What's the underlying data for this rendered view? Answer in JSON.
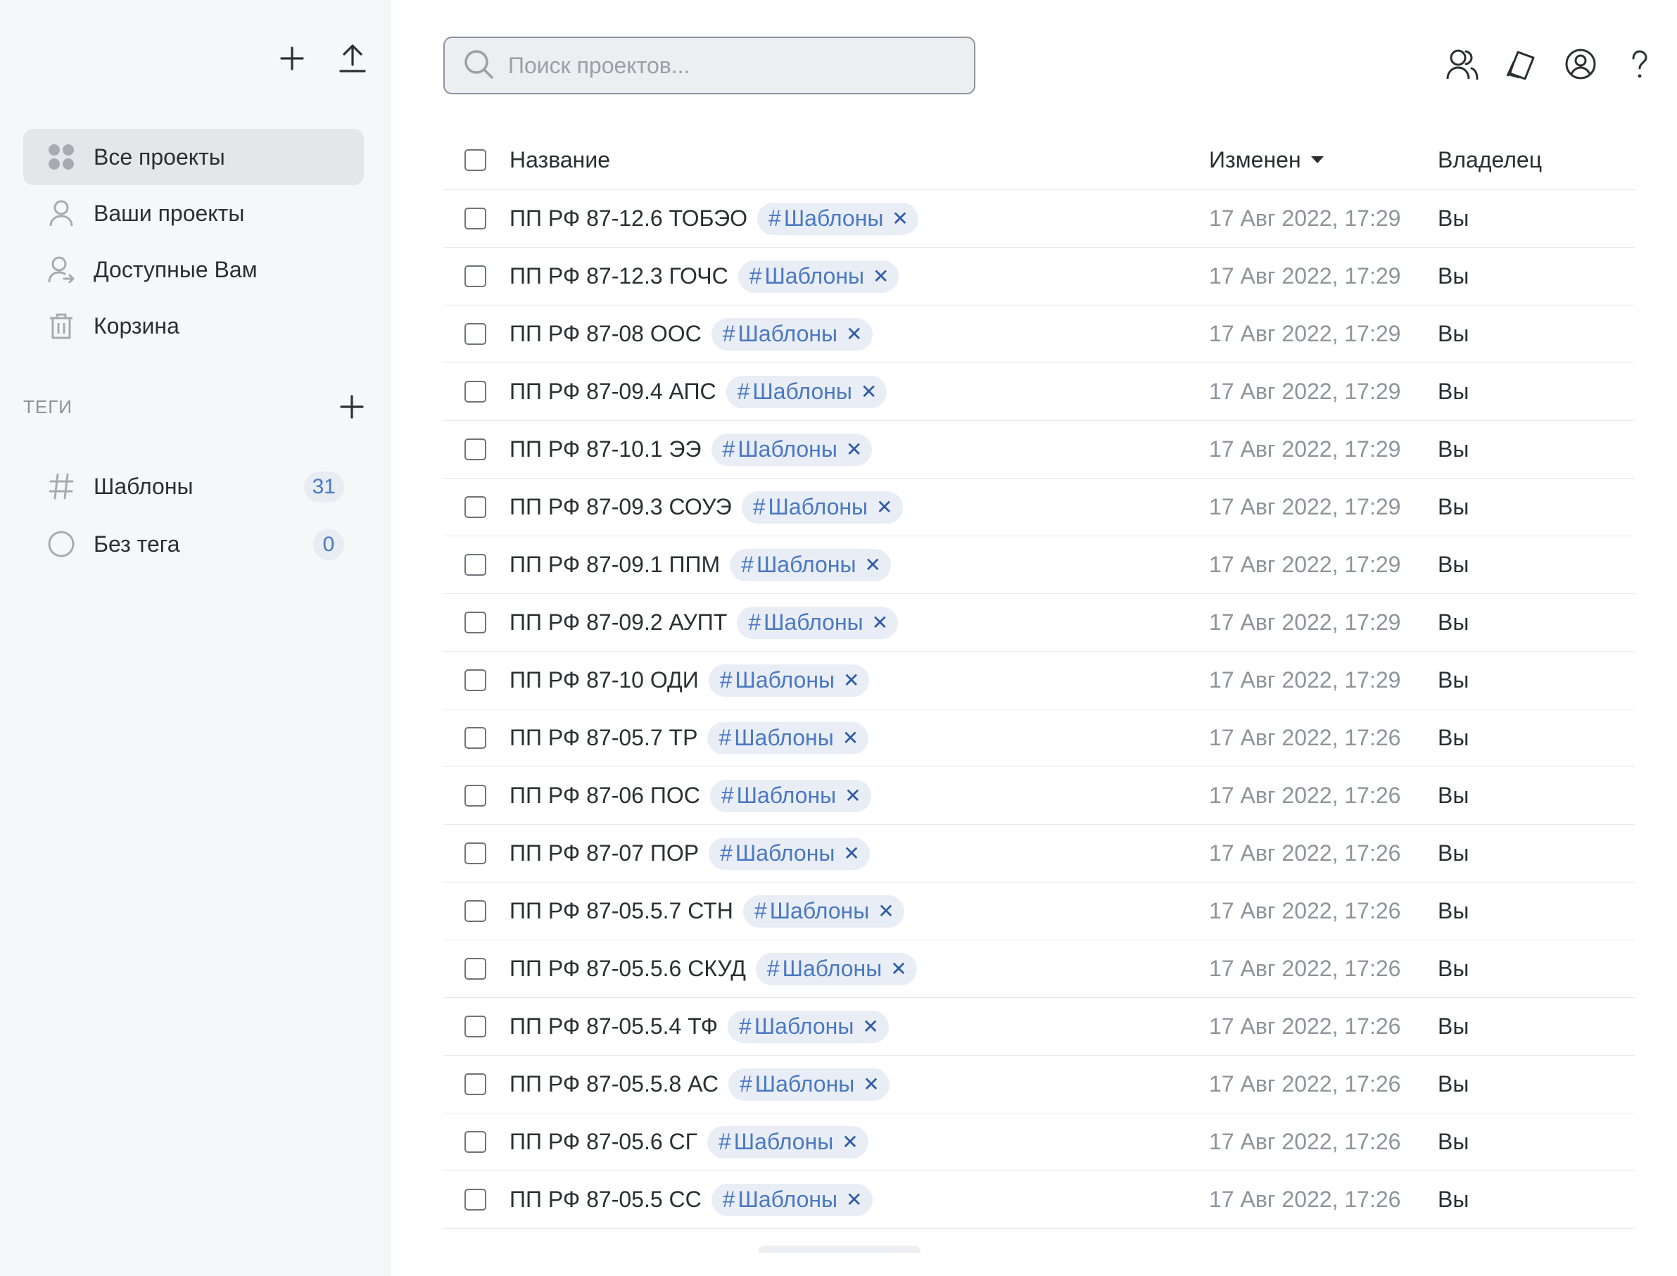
{
  "sidebar": {
    "nav": [
      {
        "label": "Все проекты",
        "icon": "grid-icon"
      },
      {
        "label": "Ваши проекты",
        "icon": "user-icon"
      },
      {
        "label": "Доступные Вам",
        "icon": "shared-user-icon"
      },
      {
        "label": "Корзина",
        "icon": "trash-icon"
      }
    ],
    "tags_title": "ТЕГИ",
    "tags": [
      {
        "label": "Шаблоны",
        "count": "31",
        "icon": "hash-icon"
      },
      {
        "label": "Без тега",
        "count": "0",
        "icon": "circle-icon"
      }
    ]
  },
  "search": {
    "placeholder": "Поиск проектов..."
  },
  "table": {
    "headers": {
      "name": "Название",
      "modified": "Изменен",
      "owner": "Владелец"
    },
    "sort": {
      "column": "modified",
      "direction": "desc"
    },
    "tag_label": "Шаблоны",
    "rows": [
      {
        "name": "ПП РФ 87-12.6 ТОБЭО",
        "tag": "Шаблоны",
        "modified": "17 Авг 2022, 17:29",
        "owner": "Вы"
      },
      {
        "name": "ПП РФ 87-12.3 ГОЧС",
        "tag": "Шаблоны",
        "modified": "17 Авг 2022, 17:29",
        "owner": "Вы"
      },
      {
        "name": "ПП РФ 87-08 ООС",
        "tag": "Шаблоны",
        "modified": "17 Авг 2022, 17:29",
        "owner": "Вы"
      },
      {
        "name": "ПП РФ 87-09.4 АПС",
        "tag": "Шаблоны",
        "modified": "17 Авг 2022, 17:29",
        "owner": "Вы"
      },
      {
        "name": "ПП РФ 87-10.1 ЭЭ",
        "tag": "Шаблоны",
        "modified": "17 Авг 2022, 17:29",
        "owner": "Вы"
      },
      {
        "name": "ПП РФ 87-09.3 СОУЭ",
        "tag": "Шаблоны",
        "modified": "17 Авг 2022, 17:29",
        "owner": "Вы"
      },
      {
        "name": "ПП РФ 87-09.1 ППМ",
        "tag": "Шаблоны",
        "modified": "17 Авг 2022, 17:29",
        "owner": "Вы"
      },
      {
        "name": "ПП РФ 87-09.2 АУПТ",
        "tag": "Шаблоны",
        "modified": "17 Авг 2022, 17:29",
        "owner": "Вы"
      },
      {
        "name": "ПП РФ 87-10 ОДИ",
        "tag": "Шаблоны",
        "modified": "17 Авг 2022, 17:29",
        "owner": "Вы"
      },
      {
        "name": "ПП РФ 87-05.7 ТР",
        "tag": "Шаблоны",
        "modified": "17 Авг 2022, 17:26",
        "owner": "Вы"
      },
      {
        "name": "ПП РФ 87-06 ПОС",
        "tag": "Шаблоны",
        "modified": "17 Авг 2022, 17:26",
        "owner": "Вы"
      },
      {
        "name": "ПП РФ 87-07 ПОР",
        "tag": "Шаблоны",
        "modified": "17 Авг 2022, 17:26",
        "owner": "Вы"
      },
      {
        "name": "ПП РФ 87-05.5.7 СТН",
        "tag": "Шаблоны",
        "modified": "17 Авг 2022, 17:26",
        "owner": "Вы"
      },
      {
        "name": "ПП РФ 87-05.5.6 СКУД",
        "tag": "Шаблоны",
        "modified": "17 Авг 2022, 17:26",
        "owner": "Вы"
      },
      {
        "name": "ПП РФ 87-05.5.4 ТФ",
        "tag": "Шаблоны",
        "modified": "17 Авг 2022, 17:26",
        "owner": "Вы"
      },
      {
        "name": "ПП РФ 87-05.5.8 АС",
        "tag": "Шаблоны",
        "modified": "17 Авг 2022, 17:26",
        "owner": "Вы"
      },
      {
        "name": "ПП РФ 87-05.6 СГ",
        "tag": "Шаблоны",
        "modified": "17 Авг 2022, 17:26",
        "owner": "Вы"
      },
      {
        "name": "ПП РФ 87-05.5 СС",
        "tag": "Шаблоны",
        "modified": "17 Авг 2022, 17:26",
        "owner": "Вы"
      }
    ]
  },
  "colors": {
    "accent": "#4a78c2",
    "sidebar_bg": "#f6f7f9",
    "active_item": "#e4e6ea",
    "chip_bg": "#e9edf5"
  }
}
